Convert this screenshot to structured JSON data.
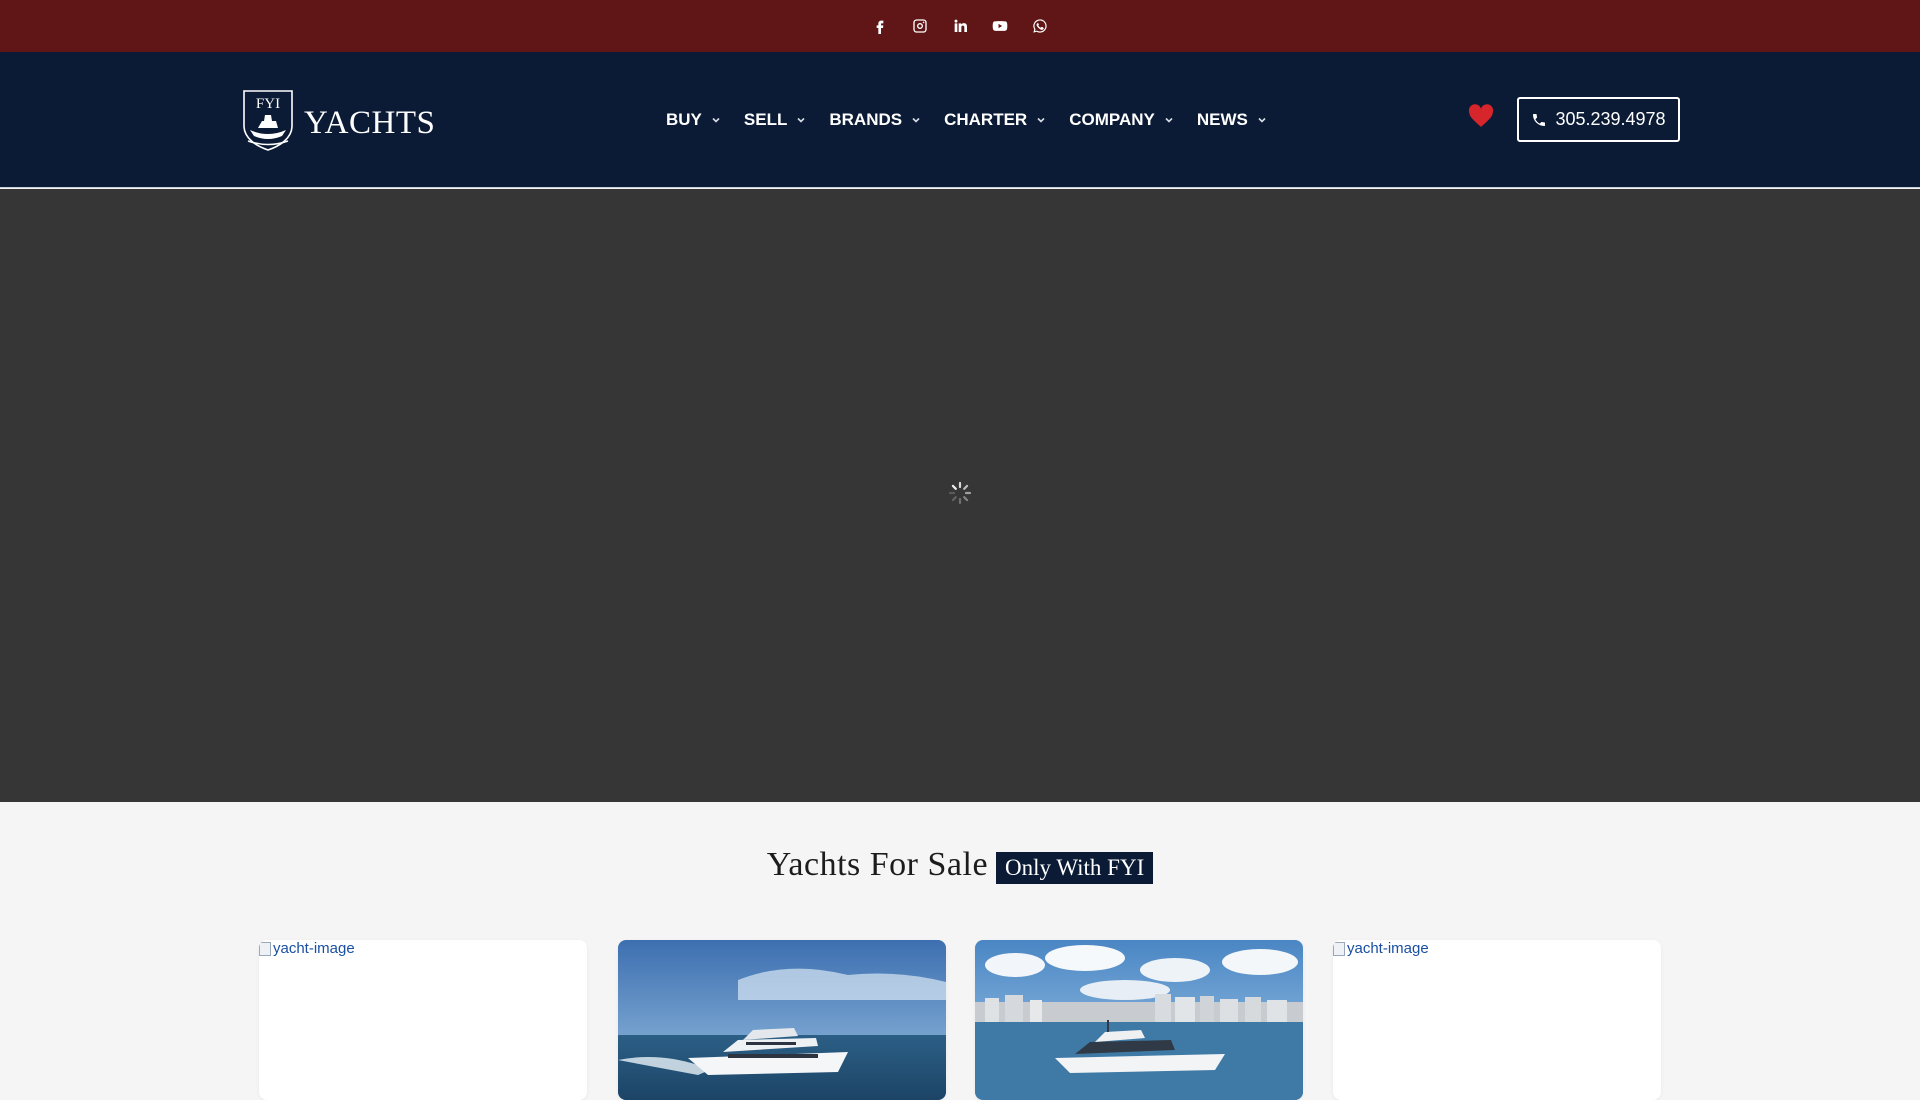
{
  "social": {
    "items": [
      "facebook-icon",
      "instagram-icon",
      "linkedin-icon",
      "youtube-icon",
      "whatsapp-icon"
    ]
  },
  "header": {
    "logo_crest": "FYI",
    "logo_word": "YACHTS",
    "nav": [
      {
        "label": "BUY"
      },
      {
        "label": "SELL"
      },
      {
        "label": "BRANDS"
      },
      {
        "label": "CHARTER"
      },
      {
        "label": "COMPANY"
      },
      {
        "label": "NEWS"
      }
    ],
    "phone": "305.239.4978"
  },
  "hero": {
    "state": "loading"
  },
  "listings": {
    "title": "Yachts For Sale",
    "tag": "Only With FYI",
    "cards": [
      {
        "image_alt": "yacht-image",
        "image_loaded": false
      },
      {
        "image_alt": "yacht-image",
        "image_loaded": true
      },
      {
        "image_alt": "yacht-image",
        "image_loaded": true
      },
      {
        "image_alt": "yacht-image",
        "image_loaded": false
      }
    ]
  },
  "colors": {
    "top_bar": "#601616",
    "header": "#0b1b35",
    "hero": "#363636",
    "heart": "#d6252b",
    "tag_bg": "#0b1b35"
  }
}
